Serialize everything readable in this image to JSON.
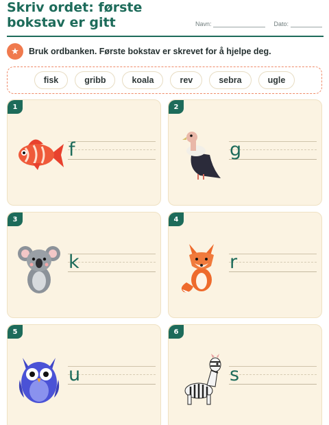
{
  "header": {
    "title": "Skriv ordet: første bokstav er gitt",
    "name_label": "Navn:",
    "date_label": "Dato:"
  },
  "instruction": {
    "icon": "star-icon",
    "text": "Bruk ordbanken. Første bokstav er skrevet for å hjelpe deg."
  },
  "word_bank": [
    "fisk",
    "gribb",
    "koala",
    "rev",
    "sebra",
    "ugle"
  ],
  "cards": [
    {
      "number": "1",
      "letter": "f",
      "animal": "fish"
    },
    {
      "number": "2",
      "letter": "g",
      "animal": "vulture"
    },
    {
      "number": "3",
      "letter": "k",
      "animal": "koala"
    },
    {
      "number": "4",
      "letter": "r",
      "animal": "fox"
    },
    {
      "number": "5",
      "letter": "u",
      "animal": "owl"
    },
    {
      "number": "6",
      "letter": "s",
      "animal": "zebra"
    }
  ],
  "colors": {
    "accent": "#1d6b5a",
    "orange": "#f07a4e",
    "card_bg": "#fbf3e2"
  }
}
